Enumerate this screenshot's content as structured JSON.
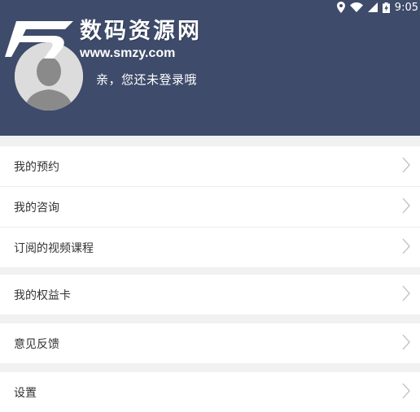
{
  "status_bar": {
    "time": "9:05"
  },
  "header": {
    "login_prompt": "亲，您还未登录哦",
    "watermark_cn": "数码资源网",
    "watermark_url": "www.smzy.com"
  },
  "menu": {
    "items": [
      {
        "label": "我的预约"
      },
      {
        "label": "我的咨询"
      },
      {
        "label": "订阅的视频课程"
      },
      {
        "label": "我的权益卡"
      },
      {
        "label": "意见反馈"
      },
      {
        "label": "设置"
      }
    ]
  },
  "colors": {
    "header_bg": "#3e4b6a",
    "page_bg": "#f1f1f1",
    "row_bg": "#ffffff",
    "text": "#333333",
    "chevron": "#bdbdbd"
  }
}
